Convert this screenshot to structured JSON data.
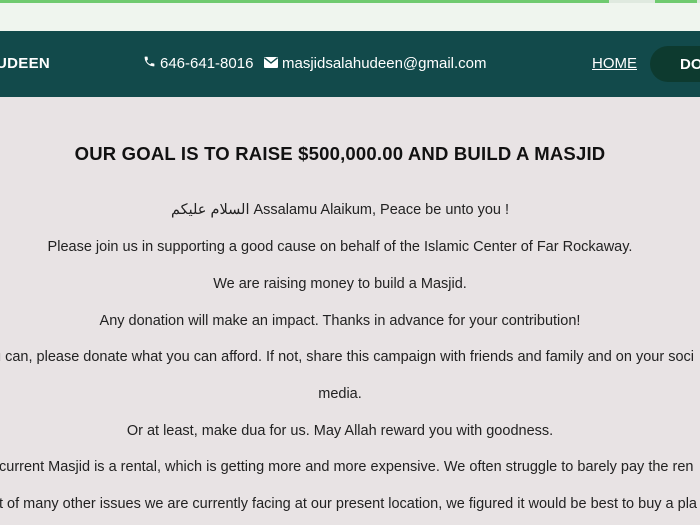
{
  "browser": {
    "progress_fraction": 0.87,
    "accent": "#6fca6f"
  },
  "nav": {
    "brand": "UDEEN",
    "phone_icon": "phone-icon",
    "phone": "646-641-8016",
    "email_icon": "envelope-icon",
    "email": "masjidsalahudeen@gmail.com",
    "home_label": "HOME",
    "donate_label": "DO",
    "bg_color": "#124a4b"
  },
  "main": {
    "headline": "OUR GOAL IS TO RAISE $500,000.00 AND BUILD A MASJID",
    "paragraphs": [
      "السلام عليكم Assalamu Alaikum, Peace be unto you !",
      "Please join us in supporting a good cause on behalf of the Islamic Center of Far Rockaway.",
      "We are raising money to build a Masjid.",
      "Any donation will make an impact. Thanks in advance for your contribution!",
      "u can, please donate what you can afford. If not, share this campaign with friends and family and on your soci",
      "media.",
      "Or at least, make dua for us. May Allah reward you with goodness.",
      "current Masjid is a rental, which is getting more and more expensive. We often struggle to barely pay the ren",
      "t of many other issues we are currently facing at our present location, we figured it would be best to buy a pla"
    ]
  }
}
